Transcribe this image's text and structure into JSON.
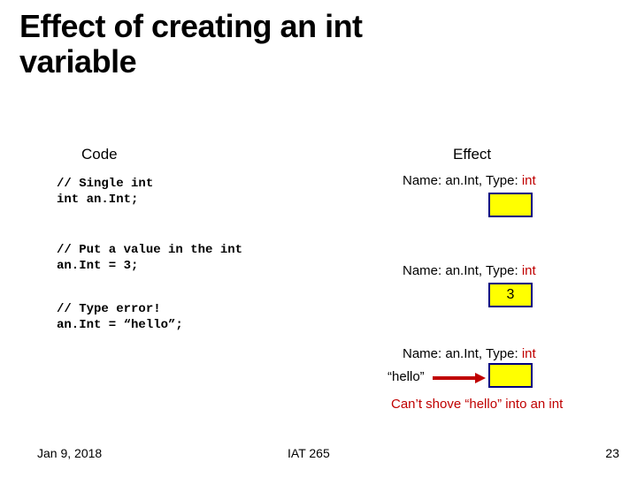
{
  "title_line1": "Effect of creating an int",
  "title_line2": "variable",
  "headers": {
    "code": "Code",
    "effect": "Effect"
  },
  "code_blocks": {
    "b1_l1": "// Single int",
    "b1_l2": "int an.Int;",
    "b2_l1": "// Put a value in the int",
    "b2_l2": "an.Int = 3;",
    "b3_l1": "// Type error!",
    "b3_l2": "an.Int = “hello”;"
  },
  "effect_labels": {
    "name_prefix": "Name: ",
    "name_value": "an.Int",
    "type_prefix": ", Type: ",
    "type_value": "int"
  },
  "box_values": {
    "b2": "3"
  },
  "hello_label": "“hello”",
  "cannot_label": "Can’t shove “hello” into an int",
  "footer": {
    "date": "Jan 9, 2018",
    "course": "IAT 265",
    "page": "23"
  }
}
